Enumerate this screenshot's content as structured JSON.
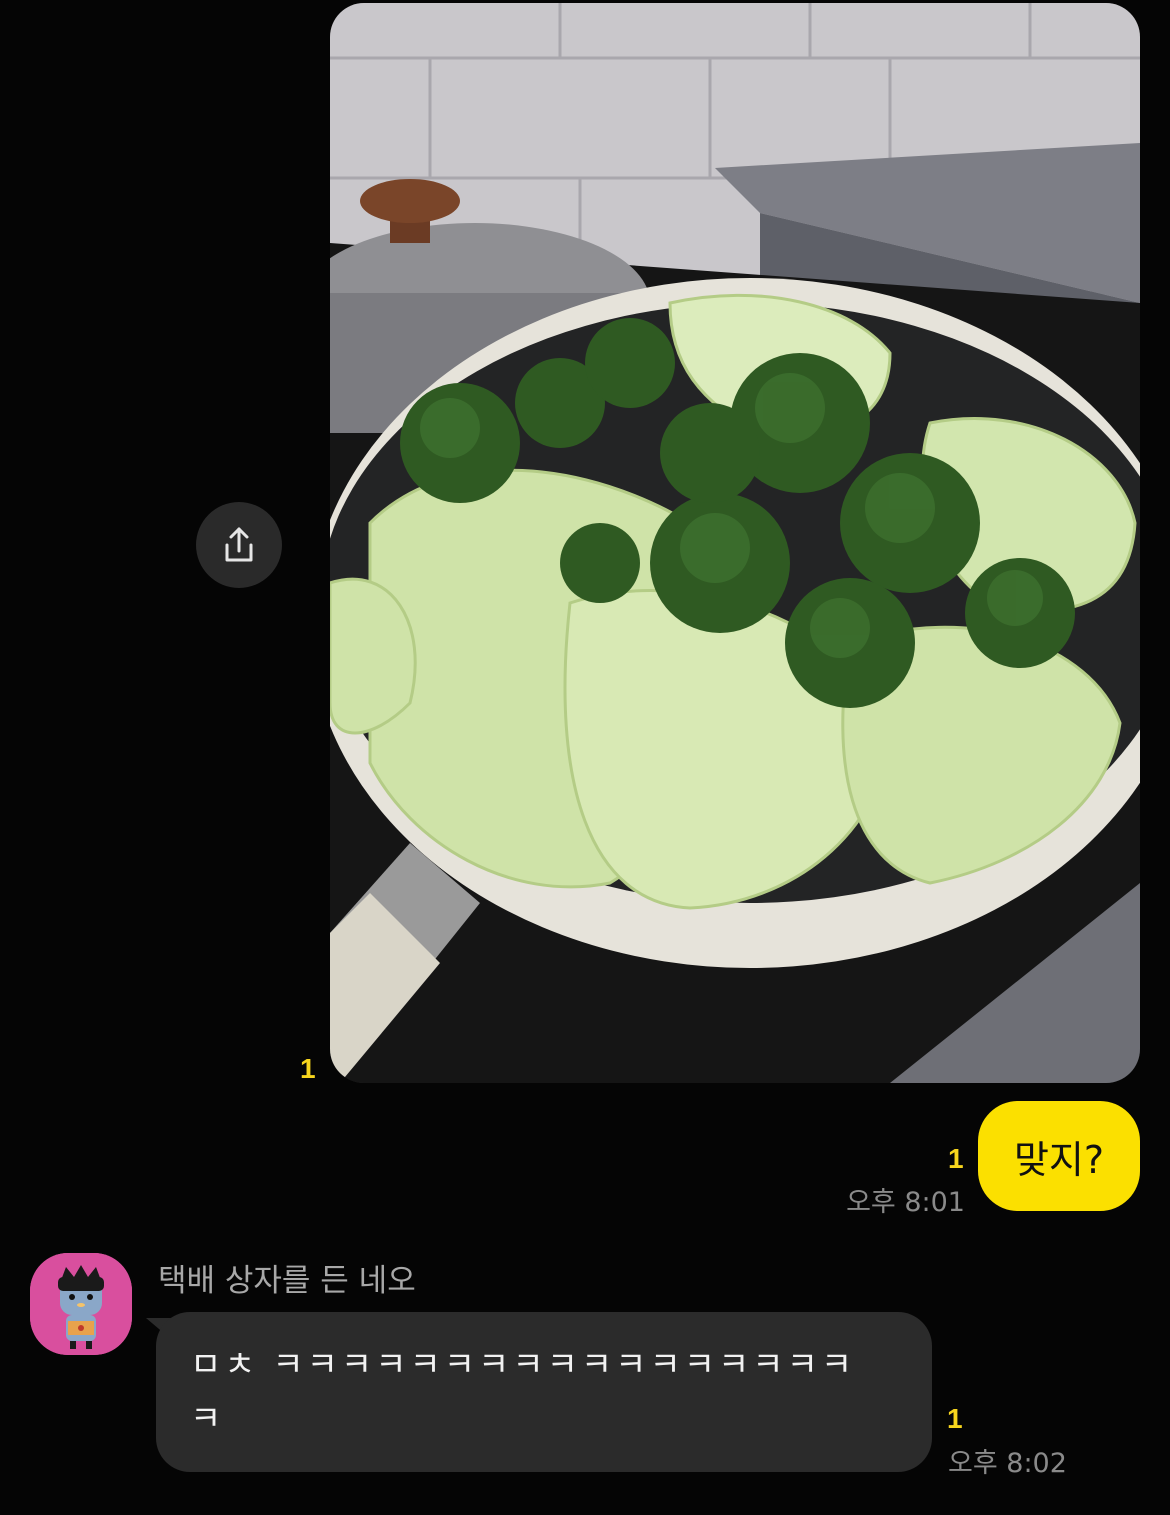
{
  "chat": {
    "photo_message": {
      "unread_count": "1",
      "alt": "photo"
    },
    "share_button": {
      "icon": "share-icon"
    },
    "my_message": {
      "text": "맞지?",
      "unread_count": "1",
      "time": "오후 8:01"
    },
    "their_message": {
      "sender": "택배 상자를 든 네오",
      "text": "ㅁㅊ ㅋㅋㅋㅋㅋㅋㅋㅋㅋㅋㅋㅋㅋㅋㅋㅋㅋ ㅋ",
      "unread_count": "1",
      "time": "오후 8:02"
    }
  },
  "colors": {
    "background": "#050505",
    "my_bubble": "#fbe000",
    "their_bubble": "#2b2b2b",
    "unread": "#f7d51d",
    "timestamp": "#8a8a8a",
    "avatar_bg": "#d94f9e"
  }
}
